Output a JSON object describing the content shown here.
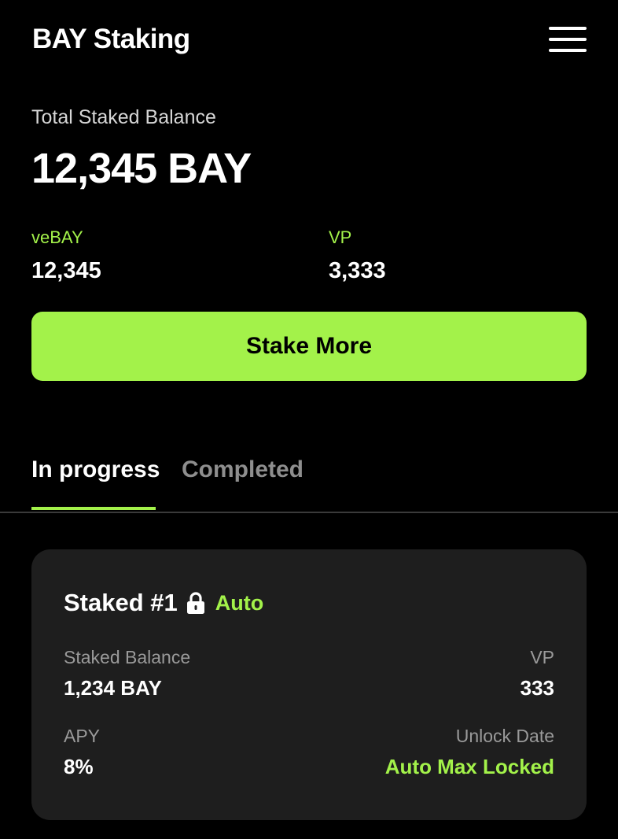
{
  "header": {
    "title": "BAY Staking",
    "menu_icon": "hamburger-menu-icon"
  },
  "summary": {
    "label": "Total Staked Balance",
    "value": "12,345 BAY",
    "vebay_label": "veBAY",
    "vebay_value": "12,345",
    "vp_label": "VP",
    "vp_value": "3,333"
  },
  "actions": {
    "stake_more_label": "Stake More"
  },
  "tabs": [
    {
      "label": "In progress",
      "active": true
    },
    {
      "label": "Completed",
      "active": false
    }
  ],
  "stakes": [
    {
      "title": "Staked #1",
      "lock_icon": "lock-icon",
      "badge": "Auto",
      "staked_balance_label": "Staked Balance",
      "staked_balance_value": "1,234 BAY",
      "vp_label": "VP",
      "vp_value": "333",
      "apy_label": "APY",
      "apy_value": "8%",
      "unlock_label": "Unlock Date",
      "unlock_value": "Auto Max Locked"
    }
  ],
  "colors": {
    "accent": "#a3f24a",
    "background": "#000000",
    "card": "#1e1e1e"
  }
}
